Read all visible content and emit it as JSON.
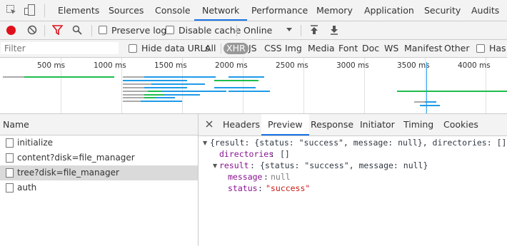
{
  "tabs": [
    {
      "label": "Elements"
    },
    {
      "label": "Sources"
    },
    {
      "label": "Console"
    },
    {
      "label": "Network"
    },
    {
      "label": "Performance"
    },
    {
      "label": "Memory"
    },
    {
      "label": "Application"
    },
    {
      "label": "Security"
    },
    {
      "label": "Audits"
    }
  ],
  "active_tab": "Network",
  "toolbar": {
    "preserve_log": "Preserve log",
    "disable_cache": "Disable cache",
    "throttle": "Online"
  },
  "filter": {
    "placeholder": "Filter",
    "hide_data_urls": "Hide data URLs",
    "types": [
      "All",
      "XHR",
      "JS",
      "CSS",
      "Img",
      "Media",
      "Font",
      "Doc",
      "WS",
      "Manifest",
      "Other"
    ],
    "active_type": "XHR",
    "has_blocked": "Has b"
  },
  "timeline": {
    "ticks": [
      "500 ms",
      "1000 ms",
      "1500 ms",
      "2000 ms",
      "2500 ms",
      "3000 ms",
      "3500 ms",
      "4000 ms"
    ]
  },
  "requests": {
    "header": "Name",
    "items": [
      {
        "name": "initialize"
      },
      {
        "name": "content?disk=file_manager"
      },
      {
        "name": "tree?disk=file_manager"
      },
      {
        "name": "auth"
      }
    ],
    "selected_index": 2
  },
  "details": {
    "tabs": [
      "Headers",
      "Preview",
      "Response",
      "Initiator",
      "Timing",
      "Cookies"
    ],
    "active": "Preview"
  },
  "preview": {
    "summary": "{result: {status: \"success\", message: null}, directories: []}",
    "directories_key": "directories",
    "directories_value": "[]",
    "result_key": "result",
    "result_summary": "{status: \"success\", message: null}",
    "message_key": "message",
    "message_value": "null",
    "status_key": "status",
    "status_value": "\"success\""
  },
  "colors": {
    "accent": "#1a73e8",
    "record": "#e0101a",
    "filter_icon": "#e0101a",
    "bar_blue": "#1e9be8",
    "bar_green": "#1ebd4d"
  }
}
